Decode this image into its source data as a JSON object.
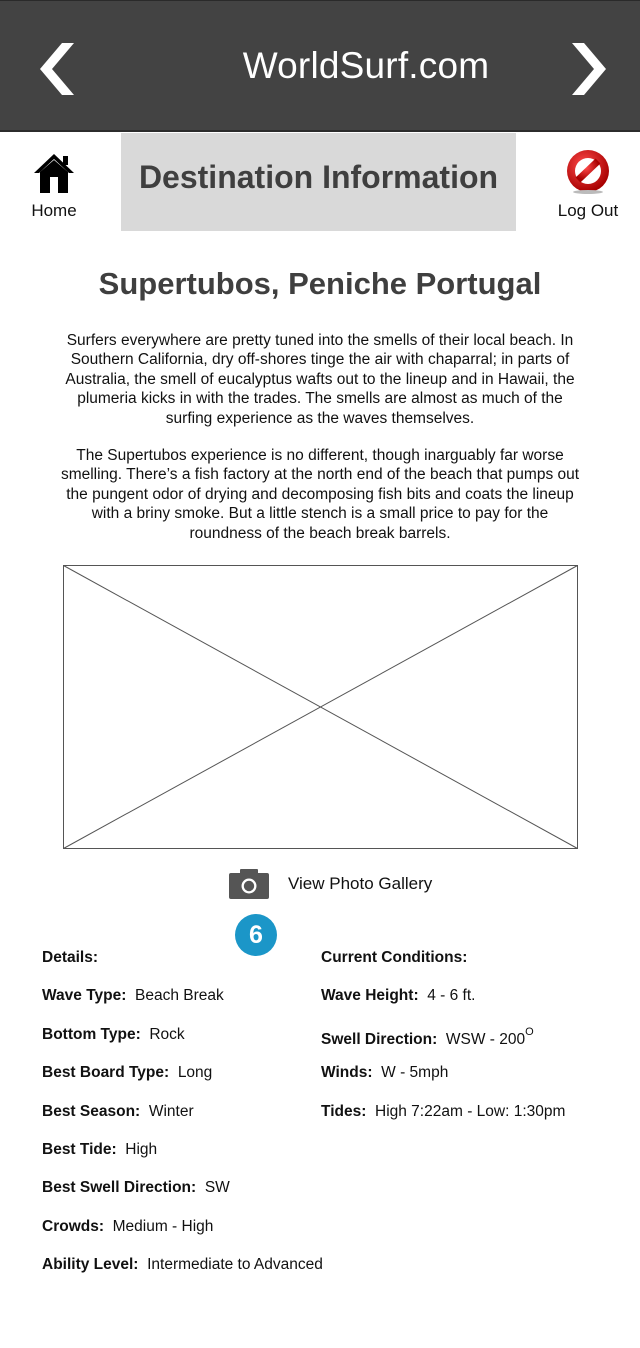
{
  "header": {
    "site_title": "WorldSurf.com",
    "back_icon": "chevron-left-icon",
    "forward_icon": "chevron-right-icon",
    "background": "#434343"
  },
  "nav": {
    "home_label": "Home",
    "home_icon": "home-icon",
    "page_title": "Destination Information",
    "logout_label": "Log Out",
    "logout_icon": "no-entry-icon"
  },
  "destination": {
    "title": "Supertubos, Peniche Portugal",
    "paragraph1": "Surfers everywhere are pretty tuned into the smells of their local beach. In Southern California, dry off-shores tinge the air with chaparral; in parts of Australia, the smell of eucalyptus wafts out to the lineup and in Hawaii, the plumeria kicks in with the trades. The smells are almost as much of the surfing experience as the waves themselves.",
    "paragraph2": "The Supertubos experience is no different, though inarguably far worse smelling. There’s a fish factory at the north end of the beach that pumps out the pungent odor of drying and decomposing fish bits and coats the lineup with a briny smoke. But a little stench is a small price to pay for the roundness of the beach break barrels."
  },
  "gallery": {
    "label": "View Photo Gallery",
    "icon": "camera-icon",
    "badge_count": "6",
    "badge_color": "#1b96c8"
  },
  "details": {
    "heading": "Details:",
    "items": [
      {
        "key": "Wave Type:",
        "value": "Beach Break"
      },
      {
        "key": "Bottom Type:",
        "value": "Rock"
      },
      {
        "key": "Best Board Type:",
        "value": "Long"
      },
      {
        "key": "Best Season:",
        "value": "Winter"
      },
      {
        "key": "Best Tide:",
        "value": "High"
      },
      {
        "key": "Best Swell Direction:",
        "value": "SW"
      },
      {
        "key": "Crowds:",
        "value": "Medium - High"
      },
      {
        "key": "Ability Level:",
        "value": "Intermediate to Advanced"
      }
    ]
  },
  "conditions": {
    "heading": "Current Conditions:",
    "items": [
      {
        "key": "Wave Height:",
        "value": "4 - 6 ft."
      },
      {
        "key": "Swell Direction:",
        "value": "WSW - 200",
        "sup": "O"
      },
      {
        "key": "Winds:",
        "value": "W - 5mph"
      },
      {
        "key": "Tides:",
        "value": "High 7:22am - Low: 1:30pm"
      }
    ]
  }
}
